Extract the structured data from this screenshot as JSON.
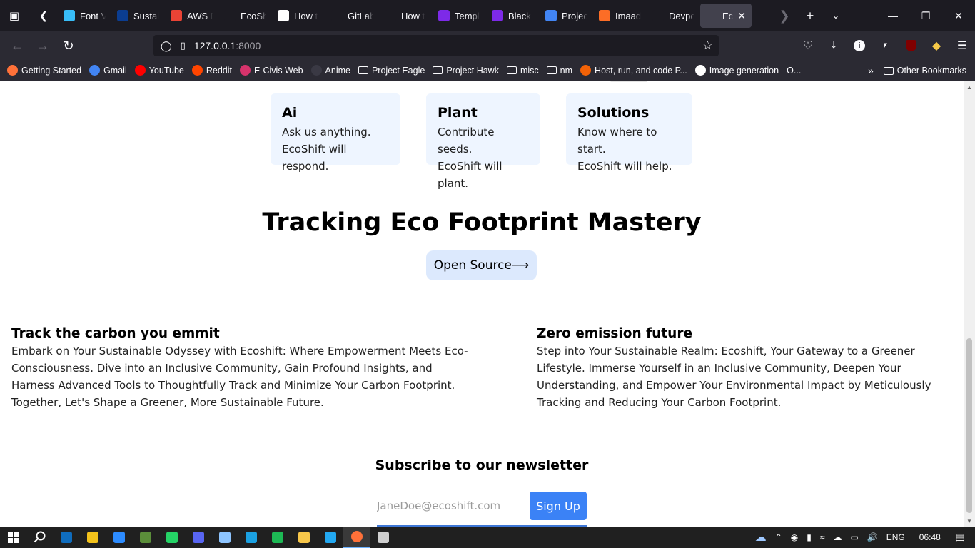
{
  "browser": {
    "tabs": [
      {
        "title": "Font V",
        "icon": "tailwind-icon",
        "color": "#38bdf8"
      },
      {
        "title": "Sustai",
        "icon": "nasa-icon",
        "color": "#0b3d91"
      },
      {
        "title": "AWS E",
        "icon": "gmail-icon",
        "color": "#ea4335"
      },
      {
        "title": "EcoShift -",
        "icon": "blank-icon",
        "color": "#1c1b22"
      },
      {
        "title": "How t",
        "icon": "medium-icon",
        "color": "#ffffff"
      },
      {
        "title": "GitLab",
        "icon": "devpost-icon",
        "color": "#1c1b22"
      },
      {
        "title": "How t",
        "icon": "astro-icon",
        "color": "#1c1b22"
      },
      {
        "title": "Templ",
        "icon": "canva-icon",
        "color": "#7d2ae8"
      },
      {
        "title": "Black",
        "icon": "canva-icon",
        "color": "#7d2ae8"
      },
      {
        "title": "Projec",
        "icon": "docs-icon",
        "color": "#4285f4"
      },
      {
        "title": "Imaad",
        "icon": "gitlab-icon",
        "color": "#fc6d26"
      },
      {
        "title": "Devpo",
        "icon": "devpost-icon",
        "color": "#1c1b22"
      },
      {
        "title": "EcoShif",
        "icon": "blank-icon",
        "color": "#42414d",
        "active": true
      }
    ],
    "url_host": "127.0.0.1",
    "url_port": ":8000",
    "bookmarks": [
      {
        "label": "Getting Started",
        "icon": "firefox-icon",
        "color": "#ff7139"
      },
      {
        "label": "Gmail",
        "icon": "google-icon",
        "color": "#4285f4"
      },
      {
        "label": "YouTube",
        "icon": "youtube-icon",
        "color": "#ff0000"
      },
      {
        "label": "Reddit",
        "icon": "reddit-icon",
        "color": "#ff4500"
      },
      {
        "label": "E-Civis Web",
        "icon": "ecivis-icon",
        "color": "#d6336c"
      },
      {
        "label": "Anime",
        "icon": "play-icon",
        "color": "#3a3944"
      },
      {
        "label": "Project Eagle",
        "icon": "folder-icon"
      },
      {
        "label": "Project Hawk",
        "icon": "folder-icon"
      },
      {
        "label": "misc",
        "icon": "folder-icon"
      },
      {
        "label": "nm",
        "icon": "folder-icon"
      },
      {
        "label": "Host, run, and code P...",
        "icon": "replit-icon",
        "color": "#f26207"
      },
      {
        "label": "Image generation - O...",
        "icon": "openai-icon",
        "color": "#ffffff"
      }
    ],
    "other_bookmarks": "Other Bookmarks"
  },
  "page": {
    "cards": [
      {
        "title": "Ai",
        "line1": "Ask us anything.",
        "line2": "EcoShift will respond."
      },
      {
        "title": "Plant",
        "line1": "Contribute seeds.",
        "line2": "EcoShift will plant."
      },
      {
        "title": "Solutions",
        "line1": "Know where to start.",
        "line2": "EcoShift will help."
      }
    ],
    "headline": "Tracking Eco Footprint Mastery",
    "open_source_label": "Open Source⟶",
    "features": [
      {
        "title": "Track the carbon you emmit",
        "body": "Embark on Your Sustainable Odyssey with Ecoshift: Where Empowerment Meets Eco-Consciousness. Dive into an Inclusive Community, Gain Profound Insights, and Harness Advanced Tools to Thoughtfully Track and Minimize Your Carbon Footprint. Together, Let's Shape a Greener, More Sustainable Future."
      },
      {
        "title": "Zero emission future",
        "body": "Step into Your Sustainable Realm: Ecoshift, Your Gateway to a Greener Lifestyle. Immerse Yourself in an Inclusive Community, Deepen Your Understanding, and Empower Your Environmental Impact by Meticulously Tracking and Reducing Your Carbon Footprint."
      }
    ],
    "newsletter": {
      "title": "Subscribe to our newsletter",
      "placeholder": "JaneDoe@ecoshift.com",
      "button": "Sign Up"
    }
  },
  "taskbar": {
    "apps": [
      {
        "icon": "outlook-icon",
        "color": "#0f6cbd"
      },
      {
        "icon": "store-icon",
        "color": "#f3c21b"
      },
      {
        "icon": "zoom-icon",
        "color": "#2d8cff"
      },
      {
        "icon": "minecraft-icon",
        "color": "#5b8e3a"
      },
      {
        "icon": "whatsapp-icon",
        "color": "#25d366"
      },
      {
        "icon": "discord-icon",
        "color": "#5865f2"
      },
      {
        "icon": "notepad-icon",
        "color": "#8ec5ff"
      },
      {
        "icon": "edge-icon",
        "color": "#1ba1e2"
      },
      {
        "icon": "spotify-icon",
        "color": "#1db954"
      },
      {
        "icon": "file-explorer-icon",
        "color": "#f8c74a"
      },
      {
        "icon": "vscode-icon",
        "color": "#23a9f2"
      },
      {
        "icon": "firefox-icon",
        "color": "#ff7139",
        "active": true
      },
      {
        "icon": "obs-icon",
        "color": "#cfcfcf"
      }
    ],
    "language": "ENG",
    "time": "06:48"
  }
}
